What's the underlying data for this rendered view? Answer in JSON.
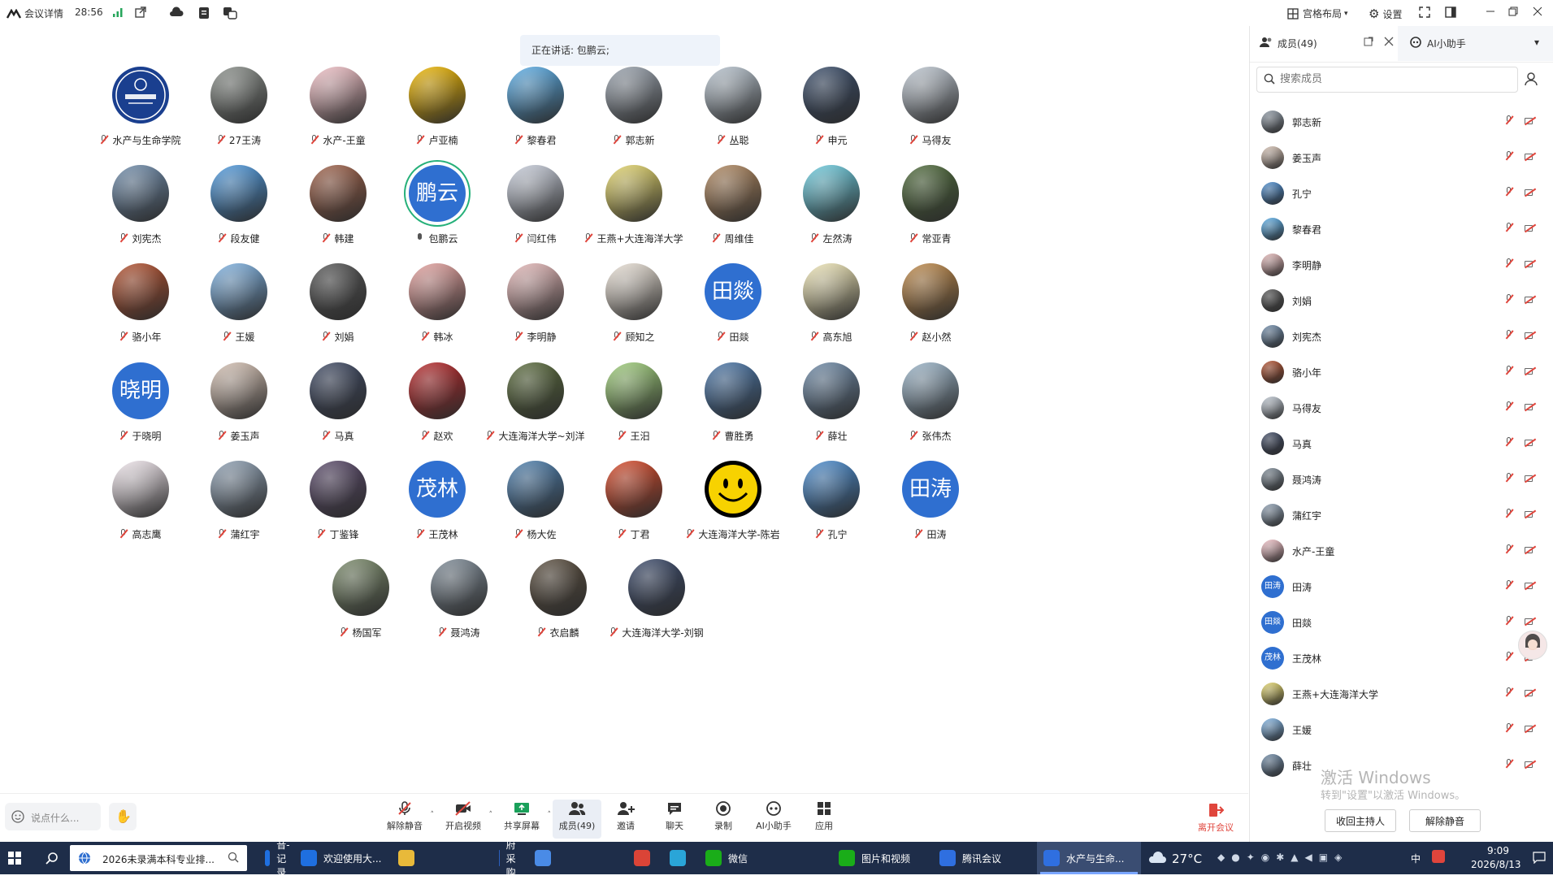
{
  "topbar": {
    "app_label": "会议详情",
    "timer": "28:56",
    "layout_label": "宫格布局",
    "settings_label": "设置"
  },
  "speaking": {
    "text": "正在讲话: 包鹏云;"
  },
  "grid": [
    {
      "name": "水产与生命学院",
      "avatar": "logo",
      "color": "#1a3f8f"
    },
    {
      "name": "27王涛",
      "avatar": "img",
      "color": "#8a8f8a"
    },
    {
      "name": "水产-王童",
      "avatar": "img",
      "color": "#f3c2c8"
    },
    {
      "name": "卢亚楠",
      "avatar": "img",
      "color": "#f0b800"
    },
    {
      "name": "黎春君",
      "avatar": "img",
      "color": "#5aaee8"
    },
    {
      "name": "郭志新",
      "avatar": "img",
      "color": "#9aa3ae"
    },
    {
      "name": "丛聪",
      "avatar": "img",
      "color": "#b8c4cf"
    },
    {
      "name": "申元",
      "avatar": "img",
      "color": "#3a4d6a"
    },
    {
      "name": "马得友",
      "avatar": "img",
      "color": "#bfc8d2"
    },
    {
      "name": "刘宪杰",
      "avatar": "img",
      "color": "#6f8cab"
    },
    {
      "name": "段友健",
      "avatar": "img",
      "color": "#4f9be0"
    },
    {
      "name": "韩建",
      "avatar": "img",
      "color": "#a0624a"
    },
    {
      "name": "包鹏云",
      "avatar": "text",
      "text": "鹏云",
      "speaking": true
    },
    {
      "name": "闫红伟",
      "avatar": "img",
      "color": "#c9cfdc"
    },
    {
      "name": "王燕+大连海洋大学",
      "avatar": "img",
      "color": "#e4d66b"
    },
    {
      "name": "周维佳",
      "avatar": "img",
      "color": "#b0875f"
    },
    {
      "name": "左然涛",
      "avatar": "img",
      "color": "#6ccde0"
    },
    {
      "name": "常亚青",
      "avatar": "img",
      "color": "#4e6a3a"
    },
    {
      "name": "骆小年",
      "avatar": "img",
      "color": "#b4512f"
    },
    {
      "name": "王媛",
      "avatar": "img",
      "color": "#7fb3e3"
    },
    {
      "name": "刘娟",
      "avatar": "img",
      "color": "#555555"
    },
    {
      "name": "韩冰",
      "avatar": "img",
      "color": "#e7a3a0"
    },
    {
      "name": "李明静",
      "avatar": "img",
      "color": "#e6b9b9"
    },
    {
      "name": "顾知之",
      "avatar": "img",
      "color": "#ece3d8"
    },
    {
      "name": "田燚",
      "avatar": "text",
      "text": "田燚"
    },
    {
      "name": "高东旭",
      "avatar": "img",
      "color": "#f1e8b8"
    },
    {
      "name": "赵小然",
      "avatar": "img",
      "color": "#c08a4a"
    },
    {
      "name": "于晓明",
      "avatar": "text",
      "text": "晓明"
    },
    {
      "name": "姜玉声",
      "avatar": "img",
      "color": "#d6c2b4"
    },
    {
      "name": "马真",
      "avatar": "img",
      "color": "#3f4a64"
    },
    {
      "name": "赵欢",
      "avatar": "img",
      "color": "#b8282a"
    },
    {
      "name": "大连海洋大学~刘洋",
      "avatar": "img",
      "color": "#5a6b3c"
    },
    {
      "name": "王汨",
      "avatar": "img",
      "color": "#9fcf7a"
    },
    {
      "name": "曹胜勇",
      "avatar": "img",
      "color": "#4a76a8"
    },
    {
      "name": "薛壮",
      "avatar": "img",
      "color": "#6e8aa7"
    },
    {
      "name": "张伟杰",
      "avatar": "img",
      "color": "#9bb5c9"
    },
    {
      "name": "高志鹰",
      "avatar": "img",
      "color": "#f2e8ee"
    },
    {
      "name": "蒲红宇",
      "avatar": "img",
      "color": "#8ea0b3"
    },
    {
      "name": "丁鉴锋",
      "avatar": "img",
      "color": "#5a4a6a"
    },
    {
      "name": "王茂林",
      "avatar": "text",
      "text": "茂林"
    },
    {
      "name": "杨大佐",
      "avatar": "img",
      "color": "#4d7fae"
    },
    {
      "name": "丁君",
      "avatar": "img",
      "color": "#d84a2a"
    },
    {
      "name": "大连海洋大学-陈岩",
      "avatar": "smiley"
    },
    {
      "name": "孔宁",
      "avatar": "img",
      "color": "#4a8ccf"
    },
    {
      "name": "田涛",
      "avatar": "text",
      "text": "田涛"
    },
    {
      "name": "杨国军",
      "avatar": "img",
      "color": "#7a8a6a"
    },
    {
      "name": "聂鸿涛",
      "avatar": "img",
      "color": "#7d8a96"
    },
    {
      "name": "衣启麟",
      "avatar": "img",
      "color": "#5a4e3f"
    },
    {
      "name": "大连海洋大学-刘钢",
      "avatar": "img",
      "color": "#3b4a6a"
    }
  ],
  "panel": {
    "members_tab": "成员(49)",
    "ai_tab": "AI小助手",
    "search_placeholder": "搜索成员",
    "members": [
      {
        "name": "郭志新",
        "avatar": "img",
        "color": "#8d98a4"
      },
      {
        "name": "姜玉声",
        "avatar": "img",
        "color": "#d6c2b4"
      },
      {
        "name": "孔宁",
        "avatar": "img",
        "color": "#4a8ccf"
      },
      {
        "name": "黎春君",
        "avatar": "img",
        "color": "#5aaee8"
      },
      {
        "name": "李明静",
        "avatar": "img",
        "color": "#e6b9b9"
      },
      {
        "name": "刘娟",
        "avatar": "img",
        "color": "#555555"
      },
      {
        "name": "刘宪杰",
        "avatar": "img",
        "color": "#6f8cab"
      },
      {
        "name": "骆小年",
        "avatar": "img",
        "color": "#b4512f"
      },
      {
        "name": "马得友",
        "avatar": "img",
        "color": "#bfc8d2"
      },
      {
        "name": "马真",
        "avatar": "img",
        "color": "#3f4a64"
      },
      {
        "name": "聂鸿涛",
        "avatar": "img",
        "color": "#7d8a96"
      },
      {
        "name": "蒲红宇",
        "avatar": "img",
        "color": "#8ea0b3"
      },
      {
        "name": "水产-王童",
        "avatar": "img",
        "color": "#f3c2c8"
      },
      {
        "name": "田涛",
        "avatar": "text",
        "text": "田涛"
      },
      {
        "name": "田燚",
        "avatar": "text",
        "text": "田燚"
      },
      {
        "name": "王茂林",
        "avatar": "text",
        "text": "茂林"
      },
      {
        "name": "王燕+大连海洋大学",
        "avatar": "img",
        "color": "#e4d66b"
      },
      {
        "name": "王媛",
        "avatar": "img",
        "color": "#7fb3e3"
      },
      {
        "name": "薛壮",
        "avatar": "img",
        "color": "#6e8aa7"
      }
    ],
    "reclaim_host": "收回主持人",
    "unmute_all": "解除静音",
    "watermark_title": "激活 Windows",
    "watermark_sub": "转到\"设置\"以激活 Windows。"
  },
  "bottombar": {
    "chat_placeholder": "说点什么...",
    "buttons": [
      {
        "label": "解除静音",
        "icon": "mic-muted-icon"
      },
      {
        "label": "开启视频",
        "icon": "camera-off-icon"
      },
      {
        "label": "共享屏幕",
        "icon": "share-screen-icon"
      },
      {
        "label": "成员(49)",
        "icon": "members-icon"
      },
      {
        "label": "邀请",
        "icon": "invite-icon"
      },
      {
        "label": "聊天",
        "icon": "chat-icon"
      },
      {
        "label": "录制",
        "icon": "record-icon"
      },
      {
        "label": "AI小助手",
        "icon": "ai-assistant-icon"
      },
      {
        "label": "应用",
        "icon": "apps-icon"
      }
    ],
    "leave_label": "离开会议"
  },
  "taskbar": {
    "search_text": "2026未录满本科专业排...",
    "tasks": [
      {
        "label": "抖音-记录美...",
        "color": "#1f6fe0"
      },
      {
        "label": "欢迎使用大...",
        "color": "#1f6fe0"
      },
      {
        "label": "",
        "color": "#e8b93a"
      },
      {
        "label": "政府采购意...",
        "color": "#2b5fbf"
      },
      {
        "label": "",
        "color": "#4a8be6"
      },
      {
        "label": "",
        "color": "#db4437"
      },
      {
        "label": "",
        "color": "#2aa5d8"
      },
      {
        "label": "微信",
        "color": "#1aad19"
      },
      {
        "label": "图片和视频",
        "color": "#1aad19"
      },
      {
        "label": "腾讯会议",
        "color": "#2f6fe0"
      },
      {
        "label": "水产与生命...",
        "color": "#2f6fe0"
      }
    ],
    "weather": "27°C",
    "ime": "中",
    "time": "9:09",
    "date": "2026/8/13"
  }
}
